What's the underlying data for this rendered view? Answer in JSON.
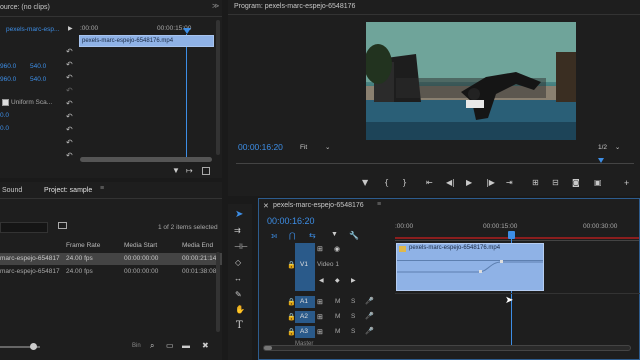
{
  "source": {
    "tab_label": "ource: (no clips)",
    "clip_label": "pexels-marc-esp...",
    "clip_name": "pexels-marc-espejo-6548176.mp4",
    "time_start": ":00:00",
    "time_mid": "00:00:15:00",
    "values": [
      "960.0",
      "540.0",
      "960.0",
      "540.0",
      "0.0",
      "0.0"
    ],
    "uniform_scale_label": "Uniform Sca..."
  },
  "program": {
    "title": "Program: pexels-marc-espejo-6548176",
    "timecode": "00:00:16:20",
    "fit_label": "Fit",
    "resolution": "1/2"
  },
  "project": {
    "tab_sound": "Sound",
    "tab_project": "Project: sample",
    "items_selected": "1 of 2 items selected",
    "columns": [
      "Frame Rate",
      "Media Start",
      "Media End"
    ],
    "rows": [
      {
        "name": "marc-espejo-654817",
        "rate": "24.00 fps",
        "start": "00:00:00:00",
        "end": "00:00:21:14"
      },
      {
        "name": "marc-espejo-654817",
        "rate": "24.00 fps",
        "start": "00:00:00:00",
        "end": "00:01:38:08"
      }
    ],
    "bin_label": "Bin"
  },
  "timeline": {
    "sequence_name": "pexels-marc-espejo-6548176",
    "timecode": "00:00:16:20",
    "ruler": [
      ":00:00",
      "00:00:15:00",
      "00:00:30:00"
    ],
    "clip_label": "pexels-marc-espejo-6548176.mp4",
    "video_track": {
      "id": "V1",
      "name": "Video 1"
    },
    "audio_tracks": [
      "A1",
      "A2",
      "A3"
    ],
    "master_label": "Master",
    "track_buttons": {
      "mute": "M",
      "solo": "S"
    }
  },
  "colors": {
    "accent": "#3d8ee6",
    "clip": "#8fb2e6",
    "track_id": "#2a5a8a"
  }
}
